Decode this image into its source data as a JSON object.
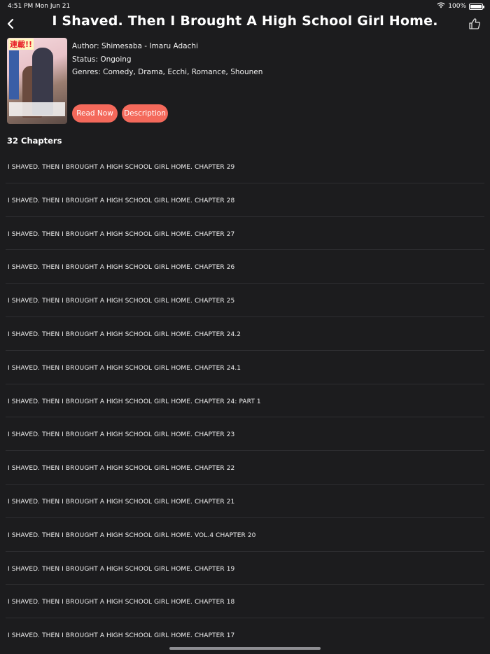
{
  "status_bar": {
    "time": "4:51 PM",
    "date": "Mon Jun 21",
    "battery": "100%"
  },
  "header": {
    "title": "I Shaved. Then I Brought A High School Girl Home."
  },
  "manga": {
    "cover_badge": "連載!!",
    "author": "Author: Shimesaba - Imaru Adachi",
    "status": "Status: Ongoing",
    "genres": "Genres: Comedy, Drama, Ecchi, Romance, Shounen"
  },
  "actions": {
    "read_now": "Read Now",
    "description": "Description"
  },
  "chapters_count": "32 Chapters",
  "chapters": [
    "I SHAVED. THEN I BROUGHT A HIGH SCHOOL GIRL HOME. CHAPTER 29",
    "I SHAVED. THEN I BROUGHT A HIGH SCHOOL GIRL HOME. CHAPTER 28",
    "I SHAVED. THEN I BROUGHT A HIGH SCHOOL GIRL HOME. CHAPTER 27",
    "I SHAVED. THEN I BROUGHT A HIGH SCHOOL GIRL HOME. CHAPTER 26",
    "I SHAVED. THEN I BROUGHT A HIGH SCHOOL GIRL HOME. CHAPTER 25",
    "I SHAVED. THEN I BROUGHT A HIGH SCHOOL GIRL HOME. CHAPTER 24.2",
    "I SHAVED. THEN I BROUGHT A HIGH SCHOOL GIRL HOME. CHAPTER 24.1",
    "I SHAVED. THEN I BROUGHT A HIGH SCHOOL GIRL HOME. CHAPTER 24: PART 1",
    "I SHAVED. THEN I BROUGHT A HIGH SCHOOL GIRL HOME. CHAPTER 23",
    "I SHAVED. THEN I BROUGHT A HIGH SCHOOL GIRL HOME. CHAPTER 22",
    "I SHAVED. THEN I BROUGHT A HIGH SCHOOL GIRL HOME. CHAPTER 21",
    "I SHAVED. THEN I BROUGHT A HIGH SCHOOL GIRL HOME. VOL.4 CHAPTER 20",
    "I SHAVED. THEN I BROUGHT A HIGH SCHOOL GIRL HOME. CHAPTER 19",
    "I SHAVED. THEN I BROUGHT A HIGH SCHOOL GIRL HOME. CHAPTER 18",
    "I SHAVED. THEN I BROUGHT A HIGH SCHOOL GIRL HOME. CHAPTER 17"
  ],
  "icons": {
    "back": "chevron-left-icon",
    "like": "thumbs-up-icon",
    "wifi": "wifi-icon",
    "battery": "battery-icon"
  },
  "colors": {
    "background": "#1c1c1e",
    "accent": "#f4695b",
    "divider": "#2e2e31"
  }
}
